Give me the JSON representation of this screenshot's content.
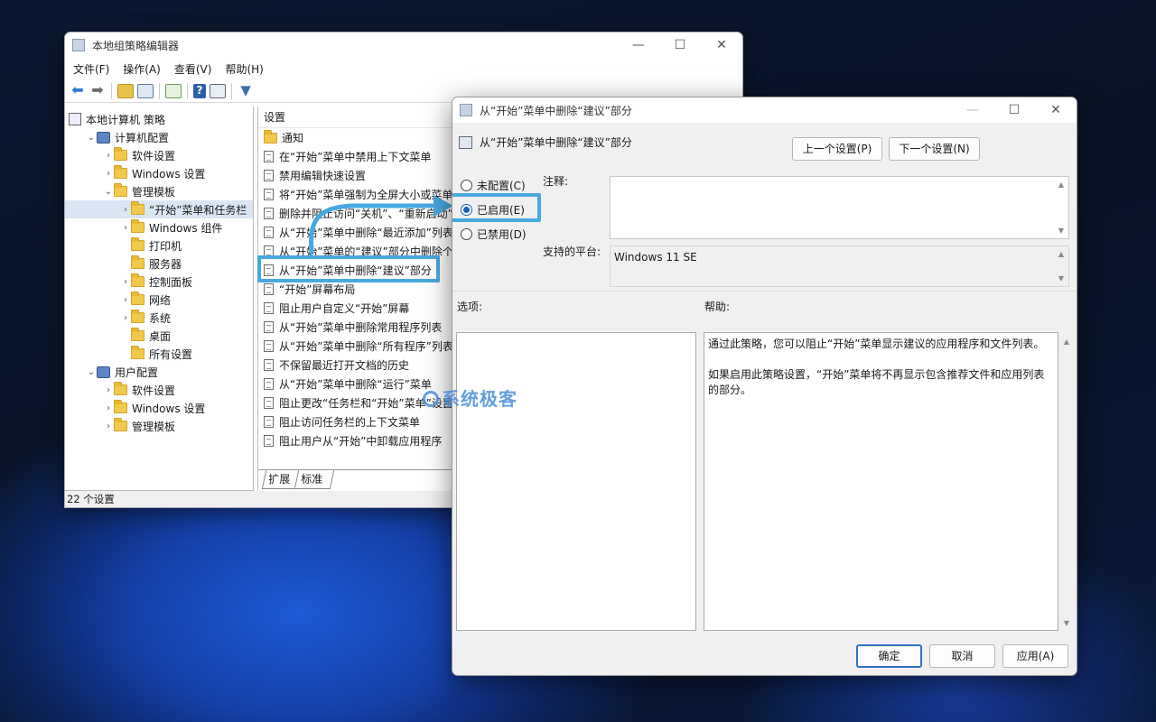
{
  "main_window": {
    "title": "本地组策略编辑器",
    "menu": [
      "文件(F)",
      "操作(A)",
      "查看(V)",
      "帮助(H)"
    ],
    "tree": [
      {
        "label": "本地计算机 策略",
        "level": 0,
        "chev": ""
      },
      {
        "label": "计算机配置",
        "level": 1,
        "chev": "⌄"
      },
      {
        "label": "软件设置",
        "level": 2,
        "chev": "›"
      },
      {
        "label": "Windows 设置",
        "level": 2,
        "chev": "›"
      },
      {
        "label": "管理模板",
        "level": 2,
        "chev": "⌄"
      },
      {
        "label": "“开始”菜单和任务栏",
        "level": 3,
        "chev": "›",
        "selected": true
      },
      {
        "label": "Windows 组件",
        "level": 3,
        "chev": "›"
      },
      {
        "label": "打印机",
        "level": 3,
        "chev": ""
      },
      {
        "label": "服务器",
        "level": 3,
        "chev": ""
      },
      {
        "label": "控制面板",
        "level": 3,
        "chev": "›"
      },
      {
        "label": "网络",
        "level": 3,
        "chev": "›"
      },
      {
        "label": "系统",
        "level": 3,
        "chev": "›"
      },
      {
        "label": "桌面",
        "level": 3,
        "chev": ""
      },
      {
        "label": "所有设置",
        "level": 3,
        "chev": ""
      },
      {
        "label": "用户配置",
        "level": 1,
        "chev": "⌄"
      },
      {
        "label": "软件设置",
        "level": 2,
        "chev": "›"
      },
      {
        "label": "Windows 设置",
        "level": 2,
        "chev": "›"
      },
      {
        "label": "管理模板",
        "level": 2,
        "chev": "›"
      }
    ],
    "list_header": "设置",
    "list_items": [
      "通知",
      "在“开始”菜单中禁用上下文菜单",
      "禁用编辑快速设置",
      "将“开始”菜单强制为全屏大小或菜单",
      "删除并阻止访问“关机”、“重新启动”",
      "从“开始”菜单中删除“最近添加”列表",
      "从“开始”菜单的“建议”部分中删除个性",
      "从“开始”菜单中删除“建议”部分",
      "“开始”屏幕布局",
      "阻止用户自定义“开始”屏幕",
      "从“开始”菜单中删除常用程序列表",
      "从“开始”菜单中删除“所有程序”列表",
      "不保留最近打开文档的历史",
      "从“开始”菜单中删除“运行”菜单",
      "阻止更改“任务栏和“开始”菜单”设置",
      "阻止访问任务栏的上下文菜单",
      "阻止用户从“开始”中卸载应用程序"
    ],
    "tabs": [
      "扩展",
      "标准"
    ],
    "status": "22 个设置"
  },
  "dialog": {
    "title": "从“开始”菜单中删除“建议”部分",
    "setting_name": "从“开始”菜单中删除“建议”部分",
    "prev_button": "上一个设置(P)",
    "next_button": "下一个设置(N)",
    "radio_not_configured": "未配置(C)",
    "radio_enabled": "已启用(E)",
    "radio_disabled": "已禁用(D)",
    "comment_label": "注释:",
    "platform_label": "支持的平台:",
    "platform_value": "Windows 11 SE",
    "options_label": "选项:",
    "help_label": "帮助:",
    "help_text_1": "通过此策略，您可以阻止“开始”菜单显示建议的应用程序和文件列表。",
    "help_text_2": "如果启用此策略设置，“开始”菜单将不再显示包含推荐文件和应用列表的部分。",
    "ok": "确定",
    "cancel": "取消",
    "apply": "应用(A)"
  },
  "watermark": "系统极客",
  "accent_color": "#48a8e0"
}
